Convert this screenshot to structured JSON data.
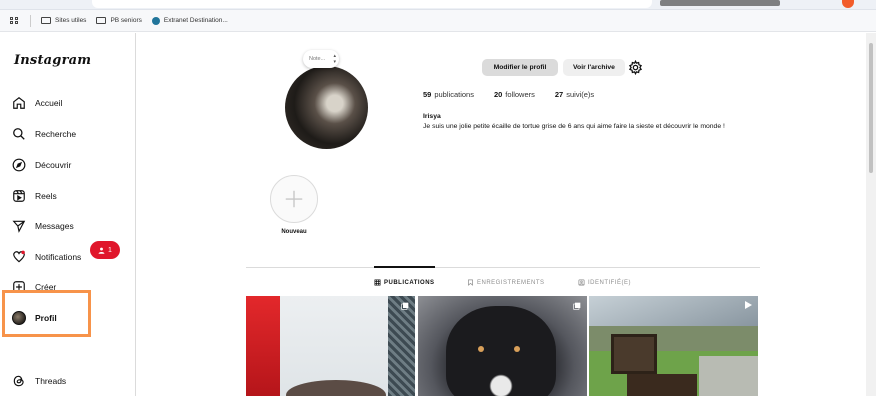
{
  "bookmarks": [
    {
      "label": "Sites utiles"
    },
    {
      "label": "PB seniors"
    },
    {
      "label": "Extranet Destination..."
    }
  ],
  "sidebar": {
    "logo": "Instagram",
    "items": [
      {
        "label": "Accueil",
        "icon": "home-icon"
      },
      {
        "label": "Recherche",
        "icon": "search-icon"
      },
      {
        "label": "Découvrir",
        "icon": "compass-icon"
      },
      {
        "label": "Reels",
        "icon": "reels-icon"
      },
      {
        "label": "Messages",
        "icon": "send-icon"
      },
      {
        "label": "Notifications",
        "icon": "heart-icon"
      },
      {
        "label": "Créer",
        "icon": "plus-square-icon"
      },
      {
        "label": "Profil",
        "icon": "avatar"
      },
      {
        "label": "Threads",
        "icon": "threads-icon"
      }
    ],
    "notification_badge": "1"
  },
  "profile": {
    "note_placeholder": "Note...",
    "edit_button": "Modifier le profil",
    "archive_button": "Voir l'archive",
    "stats": {
      "posts_count": "59",
      "posts_label": "publications",
      "followers_count": "20",
      "followers_label": "followers",
      "following_count": "27",
      "following_label": "suivi(e)s"
    },
    "username": "Irisya",
    "bio": "Je suis une jolie petite écaille de tortue grise de 6 ans qui aime faire la sieste et découvrir le monde !",
    "highlight_new": "Nouveau"
  },
  "tabs": [
    {
      "label": "PUBLICATIONS",
      "active": true
    },
    {
      "label": "ENREGISTREMENTS",
      "active": false
    },
    {
      "label": "IDENTIFIÉ(E)",
      "active": false
    }
  ],
  "colors": {
    "accent_highlight": "#f7934a",
    "badge_red": "#e0162b"
  }
}
